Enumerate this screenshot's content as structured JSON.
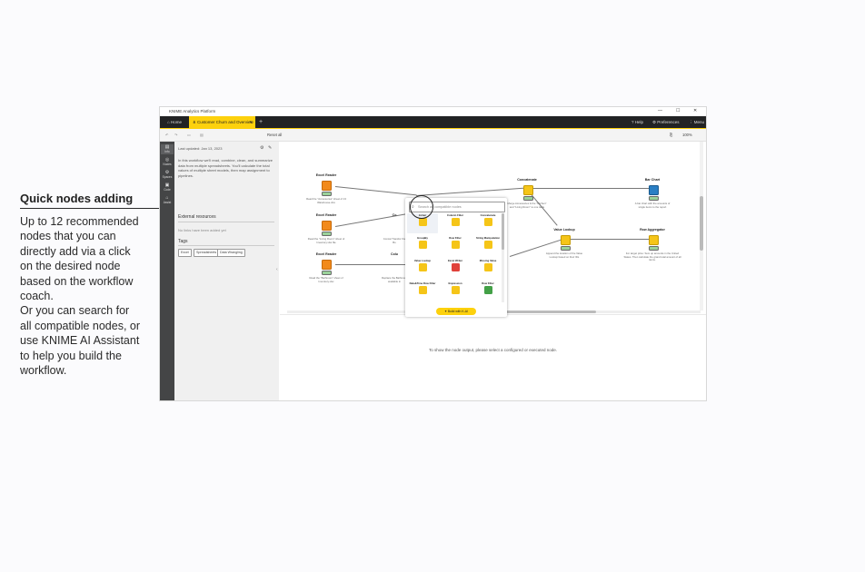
{
  "callout": {
    "title": "Quick nodes adding",
    "lines": [
      "Up to 12 recommended",
      "nodes that you can",
      "directly add via a click",
      "on the desired node",
      "based on the workflow",
      "coach.",
      "Or you can search for",
      "all compatible nodes, or",
      "use KNIME AI Assistant",
      "to help you build the",
      "workflow."
    ]
  },
  "window": {
    "title": "KNIME Analytics Platform",
    "controls": {
      "minimize": "—",
      "maximize": "☐",
      "close": "✕"
    },
    "tabs": {
      "home": "Home",
      "active": "Customer Churn and Overview",
      "active_close": "✕",
      "plus": "+"
    },
    "top_right": {
      "help": "Help",
      "preferences": "Preferences",
      "menu": "Menu"
    },
    "toolbar": {
      "items": [
        "↶",
        "↷",
        "▭",
        "▤",
        "Reset all"
      ],
      "zoom": "100%"
    }
  },
  "rail": {
    "items": [
      {
        "icon": "▤",
        "label": "Info"
      },
      {
        "icon": "◎",
        "label": "Nodes"
      },
      {
        "icon": "⚙",
        "label": "Spaces"
      },
      {
        "icon": "▣",
        "label": "Code"
      },
      {
        "icon": "⌂",
        "label": "Assist"
      }
    ]
  },
  "sidepanel": {
    "date": "Last updated: Jan 13, 2023",
    "description": "In this workflow we'll read, combine, clean, and summarize data from multiple spreadsheets. You'll calculate the total values of multiple sheet models, then map assignment to pipelines.",
    "external_heading": "External resources",
    "external_empty": "No links have been added yet",
    "tags_heading": "Tags",
    "tags": [
      "Excel",
      "Spreadsheets",
      "Data Wrangling"
    ]
  },
  "canvas": {
    "nodes": [
      {
        "id": "excel1",
        "label": "Excel Reader",
        "desc": "Read the \"Accessories\" sheet of 13 Warehouse.xlsx",
        "color": "orange"
      },
      {
        "id": "excel2",
        "label": "Excel Reader",
        "desc": "Read the \"Living Room\" sheet of Inventory.xlsx file",
        "color": "orange"
      },
      {
        "id": "excel3",
        "label": "Excel Reader",
        "desc": "Read the \"Bathroom\" sheet of Inventory.xlsx",
        "color": "orange"
      },
      {
        "id": "concat",
        "label": "Concatenate",
        "desc": "Merge Accessories & the \"Kitchen\" and \"Living Room\" to one table",
        "color": "yellow"
      },
      {
        "id": "barchart",
        "label": "Bar Chart",
        "desc": "A bar chart with the amounts of single items to the report",
        "color": "blue"
      },
      {
        "id": "valuelookup",
        "label": "Value Lookup",
        "desc": "Append the location of the Value Lookup based on their IDs",
        "color": "yellow"
      },
      {
        "id": "rowagg",
        "label": "Row Aggregator",
        "desc": "For target price: Sum up amounts in the United States. Then calculate the grand total amount of all items.",
        "color": "yellow"
      },
      {
        "id": "cut1",
        "label": "Co",
        "desc": "Concat Transfor the Bo",
        "color": "yellow"
      },
      {
        "id": "cut2",
        "label": "Colu",
        "desc": "Replace the Bathroom available in",
        "color": "yellow"
      }
    ],
    "lower_message": "To show the node output, please select a configured or executed node."
  },
  "quick_add": {
    "placeholder": "Search all compatible nodes",
    "items": [
      {
        "label": "Joiner",
        "color": "#f5c518",
        "glyph": "⋈"
      },
      {
        "label": "Column Filter",
        "color": "#f5c518",
        "glyph": "▽"
      },
      {
        "label": "Concatenate",
        "color": "#f5c518",
        "glyph": "⊕"
      },
      {
        "label": "GroupBy",
        "color": "#f5c518",
        "glyph": "Σ"
      },
      {
        "label": "Row Filter",
        "color": "#f5c518",
        "glyph": "▽"
      },
      {
        "label": "String Manipulation",
        "color": "#f5c518",
        "glyph": "ƒ"
      },
      {
        "label": "Value Lookup",
        "color": "#f5c518",
        "glyph": "⇢"
      },
      {
        "label": "Excel Writer",
        "color": "#e0413a",
        "glyph": "▦"
      },
      {
        "label": "Missing Value",
        "color": "#f5c518",
        "glyph": "?"
      },
      {
        "label": "Date&Time Row Filter",
        "color": "#f5c518",
        "glyph": "◷"
      },
      {
        "label": "Expression",
        "color": "#f5c518",
        "glyph": "ƒ"
      },
      {
        "label": "Row Filter",
        "color": "#43a047",
        "glyph": "▶"
      }
    ],
    "button": "Build with K-AI"
  }
}
